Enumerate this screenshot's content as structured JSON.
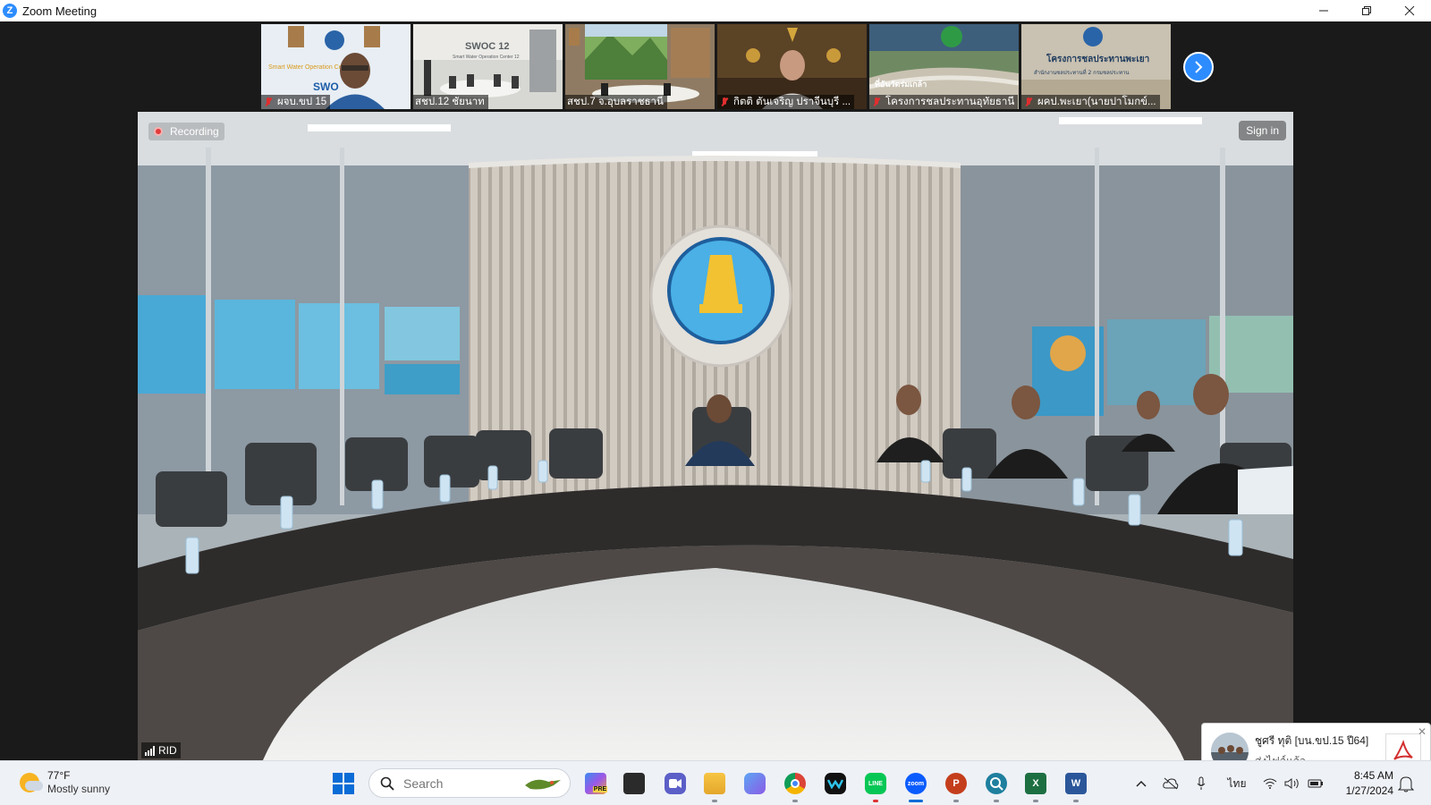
{
  "window": {
    "title": "Zoom Meeting",
    "app_icon": "zoom-logo-icon"
  },
  "window_controls": [
    "minimize-icon",
    "restore-icon",
    "close-icon"
  ],
  "thumbnails": [
    {
      "name": "ผจบ.ขป 15",
      "muted": true
    },
    {
      "name": "สชป.12 ชัยนาท",
      "muted": false
    },
    {
      "name": "สชป.7 จ.อุบลราชธานี",
      "muted": false
    },
    {
      "name": "กิตติ ตันเจริญ ปราจีนบุรี ...",
      "muted": true
    },
    {
      "name": "โครงการชลประทานอุทัยธานี",
      "muted": true
    },
    {
      "name": "ผคป.พะเยา(นายปาโมกข์...",
      "muted": true
    }
  ],
  "thumb_signs": {
    "t1": "Smart Water Operation Center 15",
    "t1b": "SWO",
    "t2": "SWOC 12",
    "t2b": "Smart Water Operation Center 12",
    "t5": "ที่อันวัดร่มเกล้า",
    "t6": "โครงการชลประทานพะเยา",
    "t6b": "สำนักงานชลประทานที่ 2 กรมชลประทาน"
  },
  "main_video": {
    "recording_label": "Recording",
    "sign_in_label": "Sign in",
    "speaker_name": "RID"
  },
  "notification": {
    "sender": "ชูศรี ทุติ [บน.ขป.15 ปี64]",
    "message": "ส่งไฟล์แล้ว",
    "file_icon": "pdf-icon"
  },
  "taskbar": {
    "weather_temp": "77°F",
    "weather_desc": "Mostly sunny",
    "search_placeholder": "Search",
    "apps": [
      {
        "name": "copilot-icon",
        "label": "PRE"
      },
      {
        "name": "task-view-icon",
        "label": ""
      },
      {
        "name": "teams-icon",
        "label": ""
      },
      {
        "name": "file-explorer-icon",
        "label": ""
      },
      {
        "name": "copilot-app-icon",
        "label": ""
      },
      {
        "name": "chrome-icon",
        "label": ""
      },
      {
        "name": "webex-icon",
        "label": ""
      },
      {
        "name": "line-icon",
        "label": "LINE"
      },
      {
        "name": "zoom-icon",
        "label": "zoom"
      },
      {
        "name": "powerpoint-icon",
        "label": "P"
      },
      {
        "name": "search-app-icon",
        "label": ""
      },
      {
        "name": "excel-icon",
        "label": "X"
      },
      {
        "name": "word-icon",
        "label": "W"
      }
    ],
    "language": "ไทย",
    "time": "8:45 AM",
    "date": "1/27/2024"
  }
}
